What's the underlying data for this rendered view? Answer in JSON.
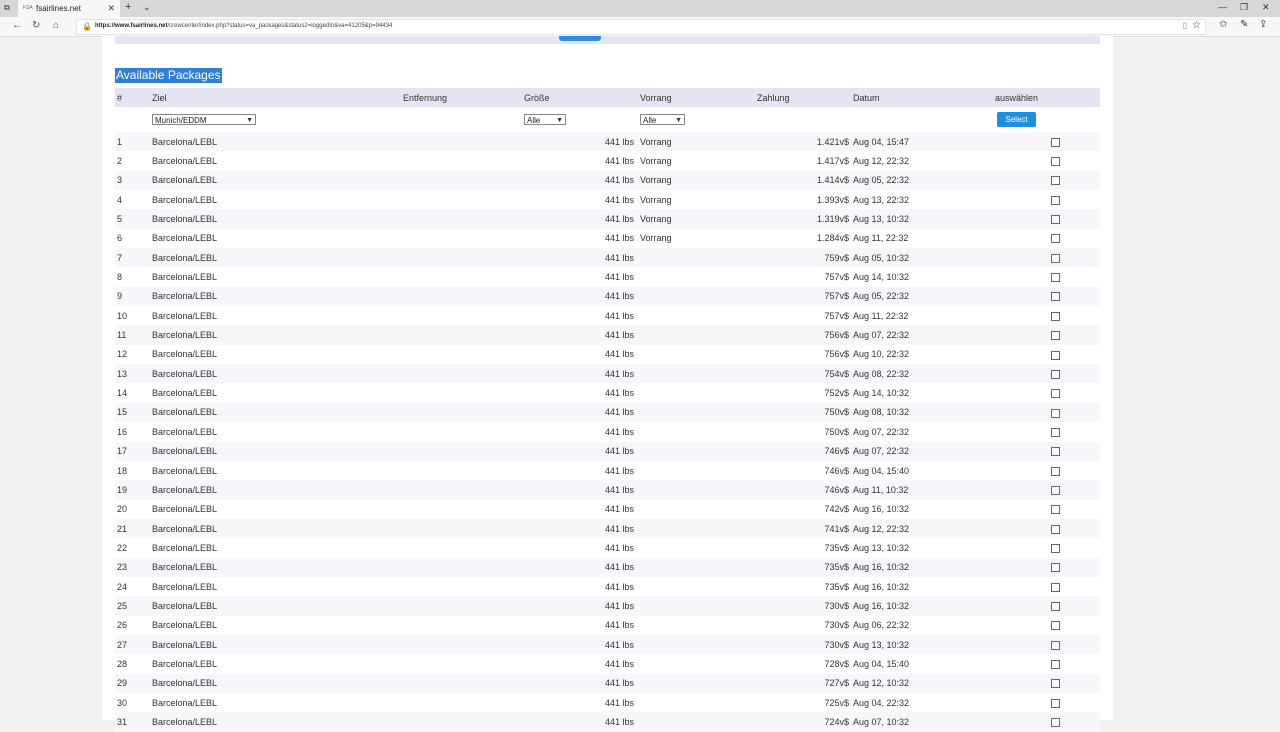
{
  "browser": {
    "tab_title": "fsairlines.net",
    "tab_favicon": "FSA",
    "url_host": "https://www.fsairlines.net",
    "url_path": "/crewcenter/index.php?status=va_packages&status2=loggedIn&va=41205&p=94434"
  },
  "page": {
    "section_title": "Available Packages",
    "headers": {
      "num": "#",
      "ziel": "Ziel",
      "entfernung": "Entfernung",
      "groesse": "Größe",
      "vorrang": "Vorrang",
      "zahlung": "Zahlung",
      "datum": "Datum",
      "auswaehlen": "auswählen"
    },
    "filters": {
      "ziel_selected": "Munich/EDDM",
      "groesse_selected": "Alle",
      "vorrang_selected": "Alle",
      "select_button": "Select"
    },
    "rows": [
      {
        "num": "1",
        "ziel": "Barcelona/LEBL",
        "groesse": "441 lbs",
        "vorrang": "Vorrang",
        "zahlung": "1.421v$",
        "datum": "Aug 04, 15:47"
      },
      {
        "num": "2",
        "ziel": "Barcelona/LEBL",
        "groesse": "441 lbs",
        "vorrang": "Vorrang",
        "zahlung": "1.417v$",
        "datum": "Aug 12, 22:32"
      },
      {
        "num": "3",
        "ziel": "Barcelona/LEBL",
        "groesse": "441 lbs",
        "vorrang": "Vorrang",
        "zahlung": "1.414v$",
        "datum": "Aug 05, 22:32"
      },
      {
        "num": "4",
        "ziel": "Barcelona/LEBL",
        "groesse": "441 lbs",
        "vorrang": "Vorrang",
        "zahlung": "1.393v$",
        "datum": "Aug 13, 22:32"
      },
      {
        "num": "5",
        "ziel": "Barcelona/LEBL",
        "groesse": "441 lbs",
        "vorrang": "Vorrang",
        "zahlung": "1.319v$",
        "datum": "Aug 13, 10:32"
      },
      {
        "num": "6",
        "ziel": "Barcelona/LEBL",
        "groesse": "441 lbs",
        "vorrang": "Vorrang",
        "zahlung": "1.284v$",
        "datum": "Aug 11, 22:32"
      },
      {
        "num": "7",
        "ziel": "Barcelona/LEBL",
        "groesse": "441 lbs",
        "vorrang": "",
        "zahlung": "759v$",
        "datum": "Aug 05, 10:32"
      },
      {
        "num": "8",
        "ziel": "Barcelona/LEBL",
        "groesse": "441 lbs",
        "vorrang": "",
        "zahlung": "757v$",
        "datum": "Aug 14, 10:32"
      },
      {
        "num": "9",
        "ziel": "Barcelona/LEBL",
        "groesse": "441 lbs",
        "vorrang": "",
        "zahlung": "757v$",
        "datum": "Aug 05, 22:32"
      },
      {
        "num": "10",
        "ziel": "Barcelona/LEBL",
        "groesse": "441 lbs",
        "vorrang": "",
        "zahlung": "757v$",
        "datum": "Aug 11, 22:32"
      },
      {
        "num": "11",
        "ziel": "Barcelona/LEBL",
        "groesse": "441 lbs",
        "vorrang": "",
        "zahlung": "756v$",
        "datum": "Aug 07, 22:32"
      },
      {
        "num": "12",
        "ziel": "Barcelona/LEBL",
        "groesse": "441 lbs",
        "vorrang": "",
        "zahlung": "756v$",
        "datum": "Aug 10, 22:32"
      },
      {
        "num": "13",
        "ziel": "Barcelona/LEBL",
        "groesse": "441 lbs",
        "vorrang": "",
        "zahlung": "754v$",
        "datum": "Aug 08, 22:32"
      },
      {
        "num": "14",
        "ziel": "Barcelona/LEBL",
        "groesse": "441 lbs",
        "vorrang": "",
        "zahlung": "752v$",
        "datum": "Aug 14, 10:32"
      },
      {
        "num": "15",
        "ziel": "Barcelona/LEBL",
        "groesse": "441 lbs",
        "vorrang": "",
        "zahlung": "750v$",
        "datum": "Aug 08, 10:32"
      },
      {
        "num": "16",
        "ziel": "Barcelona/LEBL",
        "groesse": "441 lbs",
        "vorrang": "",
        "zahlung": "750v$",
        "datum": "Aug 07, 22:32"
      },
      {
        "num": "17",
        "ziel": "Barcelona/LEBL",
        "groesse": "441 lbs",
        "vorrang": "",
        "zahlung": "746v$",
        "datum": "Aug 07, 22:32"
      },
      {
        "num": "18",
        "ziel": "Barcelona/LEBL",
        "groesse": "441 lbs",
        "vorrang": "",
        "zahlung": "746v$",
        "datum": "Aug 04, 15:40"
      },
      {
        "num": "19",
        "ziel": "Barcelona/LEBL",
        "groesse": "441 lbs",
        "vorrang": "",
        "zahlung": "746v$",
        "datum": "Aug 11, 10:32"
      },
      {
        "num": "20",
        "ziel": "Barcelona/LEBL",
        "groesse": "441 lbs",
        "vorrang": "",
        "zahlung": "742v$",
        "datum": "Aug 16, 10:32"
      },
      {
        "num": "21",
        "ziel": "Barcelona/LEBL",
        "groesse": "441 lbs",
        "vorrang": "",
        "zahlung": "741v$",
        "datum": "Aug 12, 22:32"
      },
      {
        "num": "22",
        "ziel": "Barcelona/LEBL",
        "groesse": "441 lbs",
        "vorrang": "",
        "zahlung": "735v$",
        "datum": "Aug 13, 10:32"
      },
      {
        "num": "23",
        "ziel": "Barcelona/LEBL",
        "groesse": "441 lbs",
        "vorrang": "",
        "zahlung": "735v$",
        "datum": "Aug 16, 10:32"
      },
      {
        "num": "24",
        "ziel": "Barcelona/LEBL",
        "groesse": "441 lbs",
        "vorrang": "",
        "zahlung": "735v$",
        "datum": "Aug 16, 10:32"
      },
      {
        "num": "25",
        "ziel": "Barcelona/LEBL",
        "groesse": "441 lbs",
        "vorrang": "",
        "zahlung": "730v$",
        "datum": "Aug 16, 10:32"
      },
      {
        "num": "26",
        "ziel": "Barcelona/LEBL",
        "groesse": "441 lbs",
        "vorrang": "",
        "zahlung": "730v$",
        "datum": "Aug 06, 22:32"
      },
      {
        "num": "27",
        "ziel": "Barcelona/LEBL",
        "groesse": "441 lbs",
        "vorrang": "",
        "zahlung": "730v$",
        "datum": "Aug 13, 10:32"
      },
      {
        "num": "28",
        "ziel": "Barcelona/LEBL",
        "groesse": "441 lbs",
        "vorrang": "",
        "zahlung": "728v$",
        "datum": "Aug 04, 15:40"
      },
      {
        "num": "29",
        "ziel": "Barcelona/LEBL",
        "groesse": "441 lbs",
        "vorrang": "",
        "zahlung": "727v$",
        "datum": "Aug 12, 10:32"
      },
      {
        "num": "30",
        "ziel": "Barcelona/LEBL",
        "groesse": "441 lbs",
        "vorrang": "",
        "zahlung": "725v$",
        "datum": "Aug 04, 22:32"
      },
      {
        "num": "31",
        "ziel": "Barcelona/LEBL",
        "groesse": "441 lbs",
        "vorrang": "",
        "zahlung": "724v$",
        "datum": "Aug 07, 10:32"
      }
    ]
  },
  "colors": {
    "accent": "#2f7fd6",
    "button": "#1e8fe0",
    "header_bg": "#e4e4f2"
  }
}
